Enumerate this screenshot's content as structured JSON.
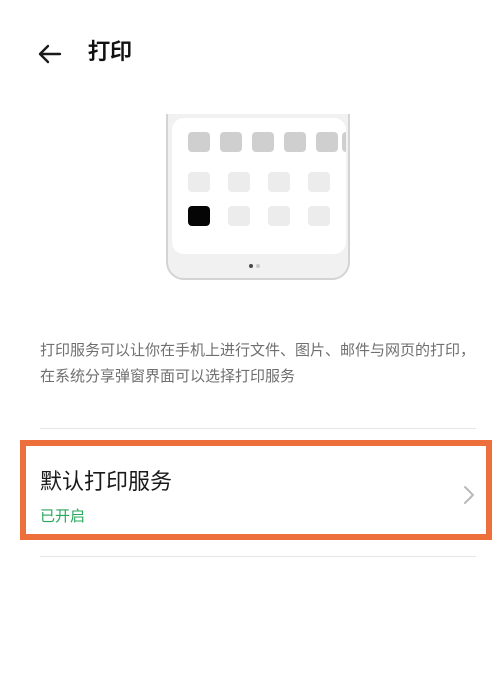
{
  "header": {
    "title": "打印",
    "back_icon": "arrow-left-icon"
  },
  "illustration": {
    "icon": "phone-share-sheet-illustration",
    "colors": {
      "selected_app": "#050505",
      "app_placeholder": "#cfcfcf",
      "frame": "#d4d4d4"
    }
  },
  "description": "打印服务可以让你在手机上进行文件、图片、邮件与网页的打印，在系统分享弹窗界面可以选择打印服务",
  "setting": {
    "label": "默认打印服务",
    "status": "已开启",
    "status_color": "#27a85a",
    "highlight_color": "#ed6f3c",
    "chevron_icon": "chevron-right-icon"
  }
}
